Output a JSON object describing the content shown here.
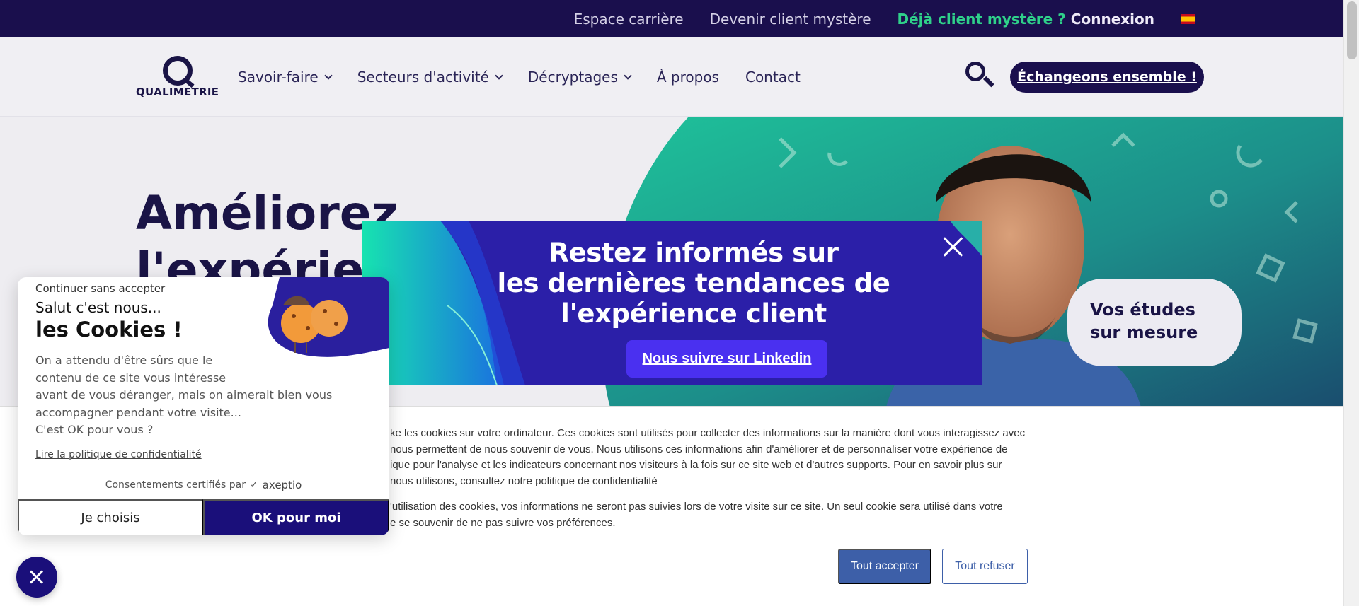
{
  "topbar": {
    "career": "Espace carrière",
    "become_shopper": "Devenir client mystère",
    "already_client": "Déjà client mystère ?",
    "login": "Connexion",
    "language_flag": "spanish-flag"
  },
  "header": {
    "logo_text": "QUALIMETRIE",
    "nav": [
      {
        "label": "Savoir-faire",
        "has_dropdown": true
      },
      {
        "label": "Secteurs d'activité",
        "has_dropdown": true
      },
      {
        "label": "Décryptages",
        "has_dropdown": true
      },
      {
        "label": "À propos",
        "has_dropdown": false
      },
      {
        "label": "Contact",
        "has_dropdown": false
      }
    ],
    "cta": "Échangeons ensemble !"
  },
  "hero": {
    "title_line1": "Améliorez",
    "title_line2": "l'expérien",
    "badge_line1": "Vos études",
    "badge_line2": "sur mesure"
  },
  "promo_popup": {
    "title_line1": "Restez informés sur",
    "title_line2": "les dernières tendances de",
    "title_line3": "l'expérience client",
    "button": "Nous suivre sur Linkedin"
  },
  "cookie_banner": {
    "paragraph1_lines": [
      "ke les cookies sur votre ordinateur. Ces cookies sont utilisés pour collecter des informations sur la manière dont vous interagissez avec",
      " nous permettent de nous souvenir de vous. Nous utilisons ces informations afin d'améliorer et de personnaliser votre expérience de",
      "ique pour l'analyse et les indicateurs concernant nos visiteurs à la fois sur ce site web et d'autres supports. Pour en savoir plus sur",
      "nous utilisons, consultez notre politique de confidentialité"
    ],
    "paragraph2_lines": [
      "'utilisation des cookies, vos informations ne seront pas suivies lors de votre visite sur ce site. Un seul cookie sera utilisé dans votre",
      "e se souvenir de ne pas suivre vos préférences."
    ],
    "accept_all": "Tout accepter",
    "refuse_all": "Tout refuser"
  },
  "axeptio": {
    "skip": "Continuer sans accepter",
    "greeting": "Salut c'est nous...",
    "title": "les Cookies !",
    "body_lines": [
      "On a attendu d'être sûrs que le",
      "contenu de ce site vous intéresse",
      "avant de vous déranger, mais on aimerait bien vous",
      "accompagner pendant votre visite...",
      "C'est OK pour vous ?"
    ],
    "policy_link": "Lire la politique de confidentialité",
    "certified": "Consentements certifiés par",
    "brand": "axeptio",
    "choose": "Je choisis",
    "ok": "OK pour moi"
  },
  "colors": {
    "navy": "#1a0f4d",
    "brand_green": "#2fd08a",
    "promo_blue": "#2b1fa8",
    "axeptio_blue": "#1a0f7a",
    "banner_button": "#3d5fa8"
  }
}
